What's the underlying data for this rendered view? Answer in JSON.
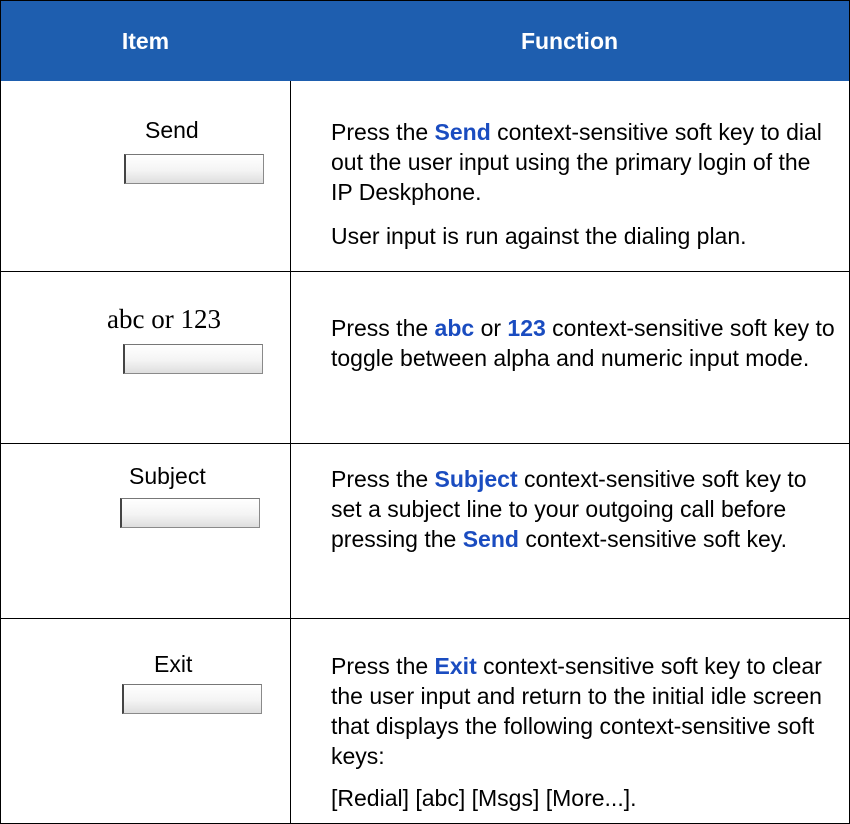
{
  "header": {
    "item": "Item",
    "function": "Function"
  },
  "rows": [
    {
      "item": "Send",
      "p1": {
        "pre": "Press the ",
        "kw": "Send",
        "post": " context-sensitive soft key to dial out the user input using the primary login of the IP Deskphone."
      },
      "p2": "User input is run against the dialing plan."
    },
    {
      "item": "abc or 123",
      "p1": {
        "pre": "Press the ",
        "kw1": "abc",
        "mid": " or ",
        "kw2": "123",
        "post": " context-sensitive soft key to toggle between alpha and numeric input mode."
      }
    },
    {
      "item": "Subject",
      "p1": {
        "pre": "Press the ",
        "kw1": "Subject",
        "mid": " context-sensitive soft key to set a subject line to your outgoing call before pressing the ",
        "kw2": "Send",
        "post": " context-sensitive soft key."
      }
    },
    {
      "item": "Exit",
      "p1": {
        "pre": "Press the ",
        "kw": "Exit",
        "post": " context-sensitive soft key to clear the user input and return to the initial idle screen that displays the following context-sensitive soft keys:"
      },
      "p2": "[Redial] [abc] [Msgs] [More...]."
    }
  ]
}
